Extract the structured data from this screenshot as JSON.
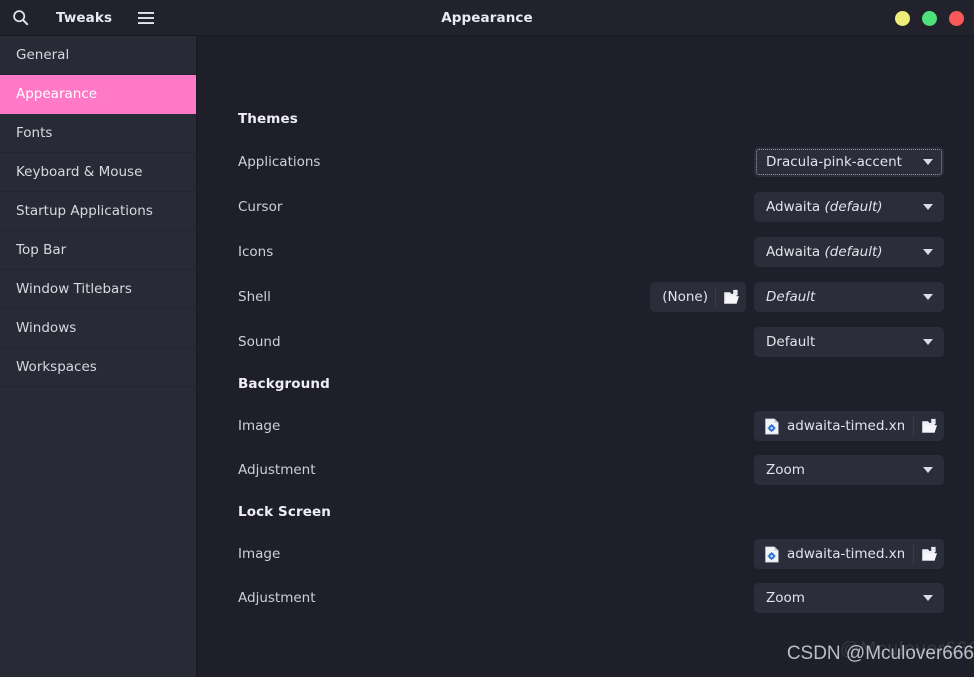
{
  "window": {
    "app_title": "Tweaks",
    "page_title": "Appearance",
    "search_icon": "search-icon",
    "menu_icon": "hamburger-menu-icon",
    "controls": [
      {
        "name": "minimize-button",
        "color": "#eded7a"
      },
      {
        "name": "maximize-button",
        "color": "#4ee07a"
      },
      {
        "name": "close-button",
        "color": "#f9595b"
      }
    ]
  },
  "colors": {
    "accent_pink": "#ff79c6",
    "sidebar_bg": "#282a36",
    "content_bg": "#1e1f29",
    "header_bg": "#21222c",
    "control_bg": "#2b2d3a"
  },
  "sidebar": {
    "items": [
      {
        "label": "General",
        "selected": false
      },
      {
        "label": "Appearance",
        "selected": true
      },
      {
        "label": "Fonts",
        "selected": false
      },
      {
        "label": "Keyboard & Mouse",
        "selected": false
      },
      {
        "label": "Startup Applications",
        "selected": false
      },
      {
        "label": "Top Bar",
        "selected": false
      },
      {
        "label": "Window Titlebars",
        "selected": false
      },
      {
        "label": "Windows",
        "selected": false
      },
      {
        "label": "Workspaces",
        "selected": false
      }
    ]
  },
  "content": {
    "sections": [
      {
        "title": "Themes",
        "rows": [
          {
            "label": "Applications",
            "control": "combo",
            "value": "Dracula-pink-accent",
            "value_suffix": "",
            "italic": false,
            "focused": true
          },
          {
            "label": "Cursor",
            "control": "combo",
            "value": "Adwaita ",
            "value_suffix": "(default)",
            "italic": false,
            "focused": false
          },
          {
            "label": "Icons",
            "control": "combo",
            "value": "Adwaita ",
            "value_suffix": "(default)",
            "italic": false,
            "focused": false
          },
          {
            "label": "Shell",
            "control": "file-and-combo",
            "file_value": "(None)",
            "value": "Default",
            "value_suffix": "",
            "italic": true,
            "focused": false
          },
          {
            "label": "Sound",
            "control": "combo",
            "value": "Default",
            "value_suffix": "",
            "italic": false,
            "focused": false
          }
        ]
      },
      {
        "title": "Background",
        "rows": [
          {
            "label": "Image",
            "control": "file",
            "file_value": "adwaita-timed.xml"
          },
          {
            "label": "Adjustment",
            "control": "combo",
            "value": "Zoom",
            "value_suffix": "",
            "italic": false,
            "focused": false
          }
        ]
      },
      {
        "title": "Lock Screen",
        "rows": [
          {
            "label": "Image",
            "control": "file",
            "file_value": "adwaita-timed.xml"
          },
          {
            "label": "Adjustment",
            "control": "combo",
            "value": "Zoom",
            "value_suffix": "",
            "italic": false,
            "focused": false
          }
        ]
      }
    ]
  },
  "watermark": {
    "text": "CSDN @Mculover666",
    "ghost_text": "@Mculover666"
  }
}
